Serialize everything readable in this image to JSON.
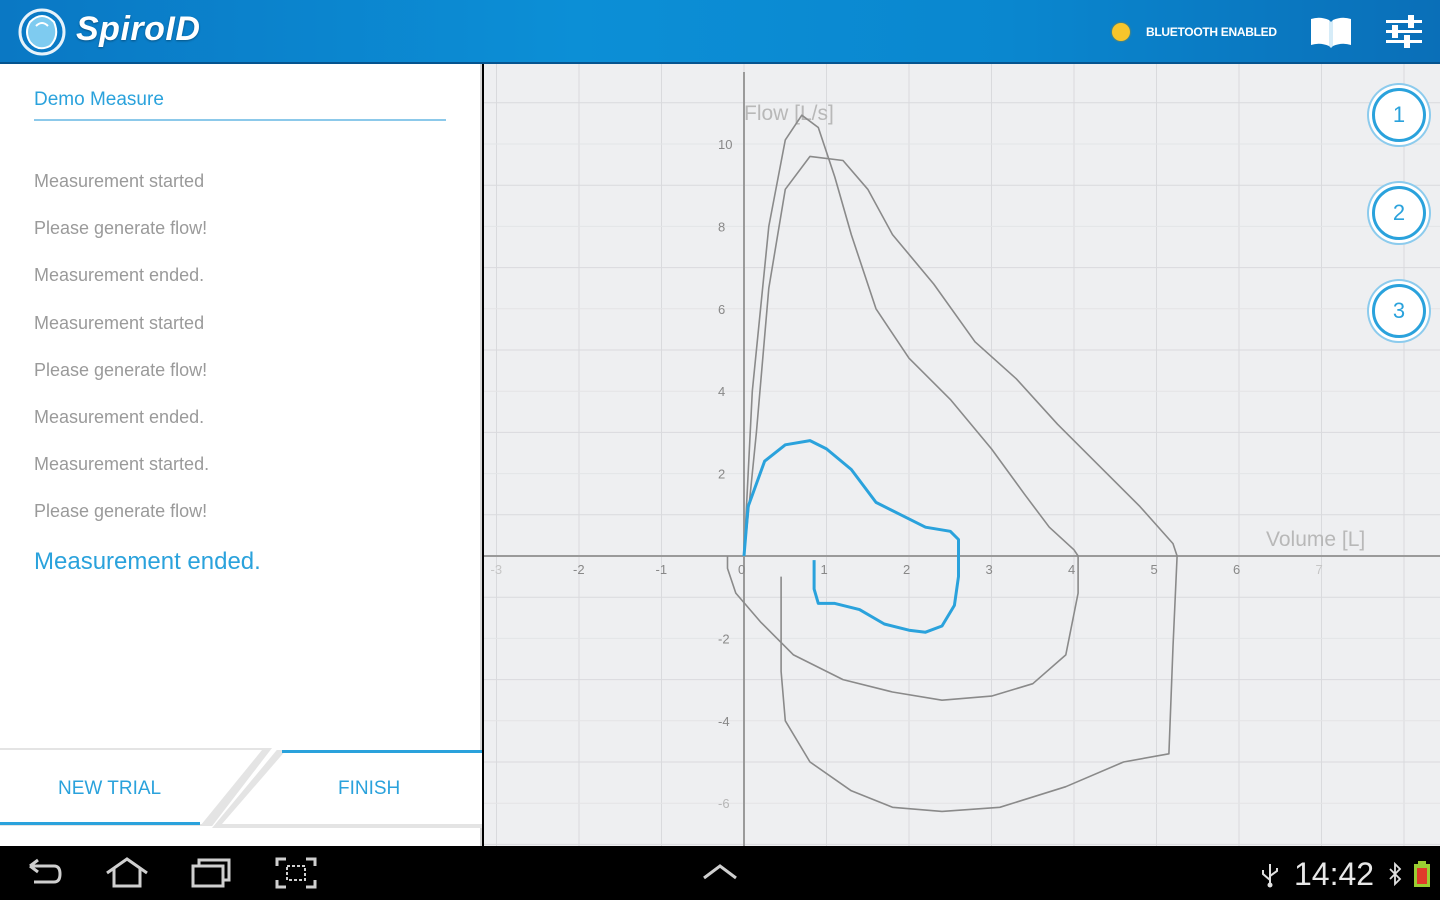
{
  "header": {
    "app_title": "SpiroID",
    "bluetooth_status": "BLUETOOTH ENABLED",
    "bluetooth_color": "#f7c52b",
    "icons": [
      "logo-icon",
      "book-icon",
      "settings-sliders-icon"
    ]
  },
  "left_panel": {
    "measure_name": "Demo Measure",
    "log": [
      "Measurement started",
      "Please generate flow!",
      "Measurement ended.",
      "Measurement started",
      "Please generate flow!",
      "Measurement ended.",
      "Measurement started.",
      "Please generate flow!",
      "Measurement ended."
    ],
    "new_trial_label": "NEW TRIAL",
    "finish_label": "FINISH"
  },
  "trials": [
    "1",
    "2",
    "3"
  ],
  "colors": {
    "accent": "#2aa2dc",
    "header": "#0c8fd6",
    "grey_curve": "#8a8a8a"
  },
  "chart_data": {
    "type": "line",
    "xlabel": "Volume [L]",
    "ylabel": "Flow [L/s]",
    "xlim": [
      -3,
      7.5
    ],
    "ylim": [
      -6.5,
      11.5
    ],
    "x_ticks": [
      -3,
      -2,
      -1,
      0,
      1,
      2,
      3,
      4,
      5,
      6,
      7
    ],
    "y_ticks": [
      -6,
      -4,
      -2,
      2,
      4,
      6,
      8,
      10
    ],
    "grid": true,
    "series": [
      {
        "color": "#8a8a8a",
        "points": [
          [
            0,
            0
          ],
          [
            0.1,
            4
          ],
          [
            0.3,
            8
          ],
          [
            0.5,
            10.1
          ],
          [
            0.7,
            10.7
          ],
          [
            0.9,
            10.4
          ],
          [
            1.1,
            9.2
          ],
          [
            1.3,
            7.8
          ],
          [
            1.6,
            6
          ],
          [
            2,
            4.8
          ],
          [
            2.5,
            3.8
          ],
          [
            3,
            2.6
          ],
          [
            3.4,
            1.5
          ],
          [
            3.7,
            0.7
          ],
          [
            4,
            0.15
          ],
          [
            4.05,
            0
          ],
          [
            4.05,
            -0.9
          ],
          [
            3.9,
            -2.4
          ],
          [
            3.5,
            -3.1
          ],
          [
            3,
            -3.4
          ],
          [
            2.4,
            -3.5
          ],
          [
            1.8,
            -3.3
          ],
          [
            1.2,
            -3
          ],
          [
            0.6,
            -2.4
          ],
          [
            0.2,
            -1.6
          ],
          [
            -0.1,
            -0.9
          ],
          [
            -0.2,
            -0.3
          ],
          [
            -0.2,
            0
          ]
        ]
      },
      {
        "color": "#8a8a8a",
        "points": [
          [
            0,
            0
          ],
          [
            0.15,
            3
          ],
          [
            0.3,
            6.5
          ],
          [
            0.5,
            8.9
          ],
          [
            0.8,
            9.7
          ],
          [
            1.2,
            9.6
          ],
          [
            1.5,
            8.9
          ],
          [
            1.8,
            7.8
          ],
          [
            2.3,
            6.6
          ],
          [
            2.8,
            5.2
          ],
          [
            3.3,
            4.3
          ],
          [
            3.8,
            3.2
          ],
          [
            4.3,
            2.2
          ],
          [
            4.8,
            1.2
          ],
          [
            5.2,
            0.3
          ],
          [
            5.25,
            0
          ],
          [
            5.2,
            -2.2
          ],
          [
            5.15,
            -4.8
          ],
          [
            4.6,
            -5
          ],
          [
            3.9,
            -5.6
          ],
          [
            3.1,
            -6.1
          ],
          [
            2.4,
            -6.2
          ],
          [
            1.8,
            -6.1
          ],
          [
            1.3,
            -5.7
          ],
          [
            0.8,
            -5
          ],
          [
            0.5,
            -4
          ],
          [
            0.45,
            -2.8
          ],
          [
            0.45,
            -0.5
          ]
        ]
      },
      {
        "color": "#2aa2dc",
        "points": [
          [
            0,
            0
          ],
          [
            0.05,
            1.2
          ],
          [
            0.25,
            2.3
          ],
          [
            0.5,
            2.7
          ],
          [
            0.8,
            2.8
          ],
          [
            1,
            2.6
          ],
          [
            1.3,
            2.1
          ],
          [
            1.6,
            1.3
          ],
          [
            1.9,
            1
          ],
          [
            2.2,
            0.7
          ],
          [
            2.5,
            0.6
          ],
          [
            2.6,
            0.4
          ],
          [
            2.6,
            -0.5
          ],
          [
            2.55,
            -1.2
          ],
          [
            2.4,
            -1.7
          ],
          [
            2.2,
            -1.85
          ],
          [
            2,
            -1.8
          ],
          [
            1.7,
            -1.65
          ],
          [
            1.4,
            -1.3
          ],
          [
            1.1,
            -1.15
          ],
          [
            0.9,
            -1.15
          ],
          [
            0.85,
            -0.8
          ],
          [
            0.85,
            -0.1
          ]
        ]
      }
    ]
  },
  "status_bar": {
    "time": "14:42"
  }
}
